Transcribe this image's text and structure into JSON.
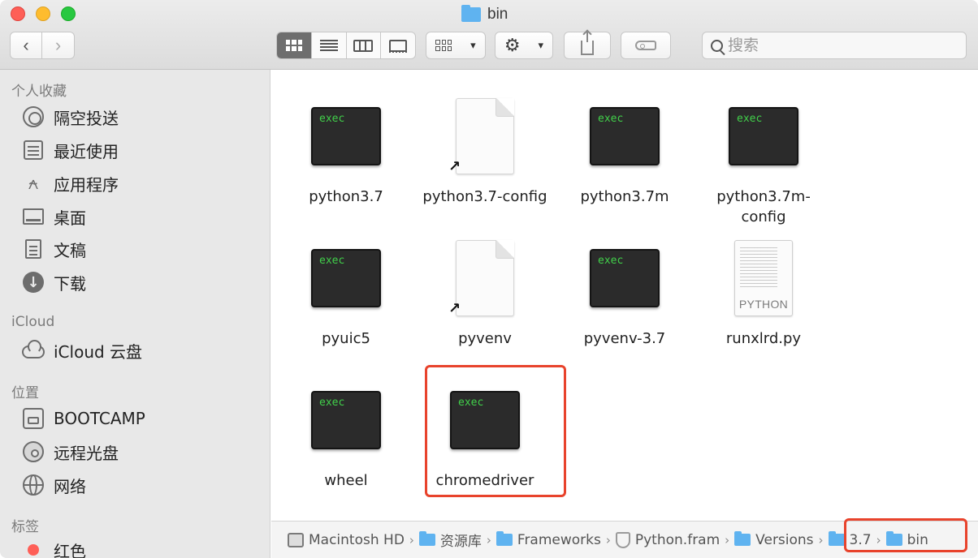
{
  "window": {
    "title": "bin"
  },
  "search": {
    "placeholder": "搜索"
  },
  "sidebar": {
    "favorites_title": "个人收藏",
    "favorites": [
      {
        "label": "隔空投送",
        "icon": "airdrop-icon"
      },
      {
        "label": "最近使用",
        "icon": "recents-icon"
      },
      {
        "label": "应用程序",
        "icon": "applications-icon"
      },
      {
        "label": "桌面",
        "icon": "desktop-icon"
      },
      {
        "label": "文稿",
        "icon": "documents-icon"
      },
      {
        "label": "下载",
        "icon": "downloads-icon"
      }
    ],
    "icloud_title": "iCloud",
    "icloud": [
      {
        "label": "iCloud 云盘",
        "icon": "cloud-icon"
      }
    ],
    "locations_title": "位置",
    "locations": [
      {
        "label": "BOOTCAMP",
        "icon": "drive-icon"
      },
      {
        "label": "远程光盘",
        "icon": "disc-icon"
      },
      {
        "label": "网络",
        "icon": "network-icon"
      }
    ],
    "tags_title": "标签",
    "tags": [
      {
        "label": "红色",
        "color": "#fe5f57"
      }
    ]
  },
  "files": [
    {
      "name": "python3.7",
      "kind": "exec"
    },
    {
      "name": "python3.7-config",
      "kind": "alias"
    },
    {
      "name": "python3.7m",
      "kind": "exec"
    },
    {
      "name": "python3.7m-config",
      "kind": "exec"
    },
    {
      "name": "pyuic5",
      "kind": "exec"
    },
    {
      "name": "pyvenv",
      "kind": "alias"
    },
    {
      "name": "pyvenv-3.7",
      "kind": "exec"
    },
    {
      "name": "runxlrd.py",
      "kind": "python",
      "badge": "PYTHON"
    },
    {
      "name": "wheel",
      "kind": "exec"
    },
    {
      "name": "chromedriver",
      "kind": "exec",
      "highlighted": true
    }
  ],
  "exec_label": "exec",
  "pathbar": {
    "items": [
      {
        "label": "Macintosh HD",
        "icon": "hard-drive-icon"
      },
      {
        "label": "资源库",
        "icon": "folder-icon"
      },
      {
        "label": "Frameworks",
        "icon": "folder-icon"
      },
      {
        "label": "Python.fram",
        "icon": "framework-icon"
      },
      {
        "label": "Versions",
        "icon": "folder-icon"
      },
      {
        "label": "3.7",
        "icon": "folder-icon"
      },
      {
        "label": "bin",
        "icon": "folder-icon"
      }
    ]
  },
  "colors": {
    "highlight": "#e8432c",
    "folder": "#5fb3f0",
    "exec_text": "#41d04a"
  }
}
